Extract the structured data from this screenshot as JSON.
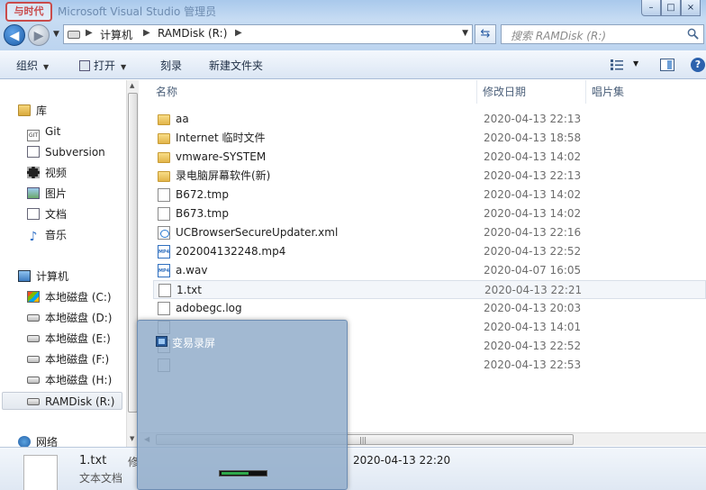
{
  "window": {
    "title": "Microsoft Visual Studio 管理员",
    "logo_text": "与时代",
    "buttons": {
      "minimize": "–",
      "maximize": "□",
      "close": "×"
    }
  },
  "address": {
    "segments": [
      "计算机",
      "RAMDisk (R:)"
    ],
    "search_placeholder": "搜索 RAMDisk (R:)"
  },
  "toolbar": {
    "organize": "组织",
    "open": "打开",
    "burn": "刻录",
    "new_folder": "新建文件夹",
    "help": "?"
  },
  "nav": {
    "library": "库",
    "library_items": [
      "Git",
      "Subversion",
      "视频",
      "图片",
      "文档",
      "音乐"
    ],
    "computer": "计算机",
    "drives": [
      "本地磁盘 (C:)",
      "本地磁盘 (D:)",
      "本地磁盘 (E:)",
      "本地磁盘 (F:)",
      "本地磁盘 (H:)",
      "RAMDisk (R:)"
    ],
    "network": "网络"
  },
  "columns": {
    "name": "名称",
    "modified": "修改日期",
    "album": "唱片集"
  },
  "files": [
    {
      "name": "aa",
      "date": "2020-04-13 22:13",
      "kind": "folder"
    },
    {
      "name": "Internet 临时文件",
      "date": "2020-04-13 18:58",
      "kind": "folder"
    },
    {
      "name": "vmware-SYSTEM",
      "date": "2020-04-13 14:02",
      "kind": "folder"
    },
    {
      "name": "录电脑屏幕软件(新)",
      "date": "2020-04-13 22:13",
      "kind": "folder"
    },
    {
      "name": "B672.tmp",
      "date": "2020-04-13 14:02",
      "kind": "file"
    },
    {
      "name": "B673.tmp",
      "date": "2020-04-13 14:02",
      "kind": "file"
    },
    {
      "name": "UCBrowserSecureUpdater.xml",
      "date": "2020-04-13 22:16",
      "kind": "xml"
    },
    {
      "name": "202004132248.mp4",
      "date": "2020-04-13 22:52",
      "kind": "media"
    },
    {
      "name": "a.wav",
      "date": "2020-04-07 16:05",
      "kind": "media"
    },
    {
      "name": "1.txt",
      "date": "2020-04-13 22:21",
      "kind": "file"
    },
    {
      "name": "adobegc.log",
      "date": "2020-04-13 20:03",
      "kind": "file"
    },
    {
      "name": "",
      "date": "2020-04-13 14:01",
      "kind": "file"
    },
    {
      "name": "",
      "date": "2020-04-13 22:52",
      "kind": "file"
    },
    {
      "name": "",
      "date": "2020-04-13 22:53",
      "kind": "file"
    }
  ],
  "details": {
    "name": "1.txt",
    "type": "文本文档",
    "label": "修",
    "date": "2020-04-13 22:20"
  },
  "overlay": {
    "title": "变易录屏"
  }
}
